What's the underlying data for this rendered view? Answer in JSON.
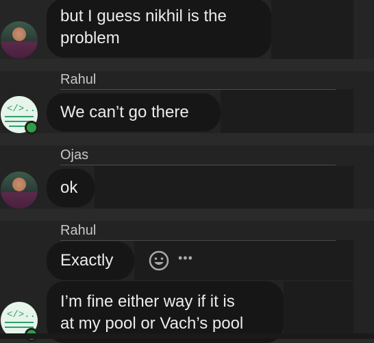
{
  "messages": [
    {
      "sender": "",
      "lines": [
        "but I guess nikhil is the",
        "problem"
      ]
    },
    {
      "sender": "Rahul",
      "lines": [
        "We can’t go there"
      ]
    },
    {
      "sender": "Ojas",
      "lines": [
        "ok"
      ]
    },
    {
      "sender": "Rahul",
      "lines": [
        "Exactly"
      ]
    },
    {
      "sender": "",
      "lines": [
        "I’m fine either way if it is",
        "at my pool or Vach’s pool"
      ]
    }
  ],
  "actions": {
    "more_label": "•••"
  },
  "icons": {
    "emoji": "emoji-icon",
    "more": "more-icon",
    "code_avatar": "code-icon"
  },
  "colors": {
    "status_online": "#2f9e44",
    "bubble": "#161616",
    "background": "#2a2a2a"
  }
}
